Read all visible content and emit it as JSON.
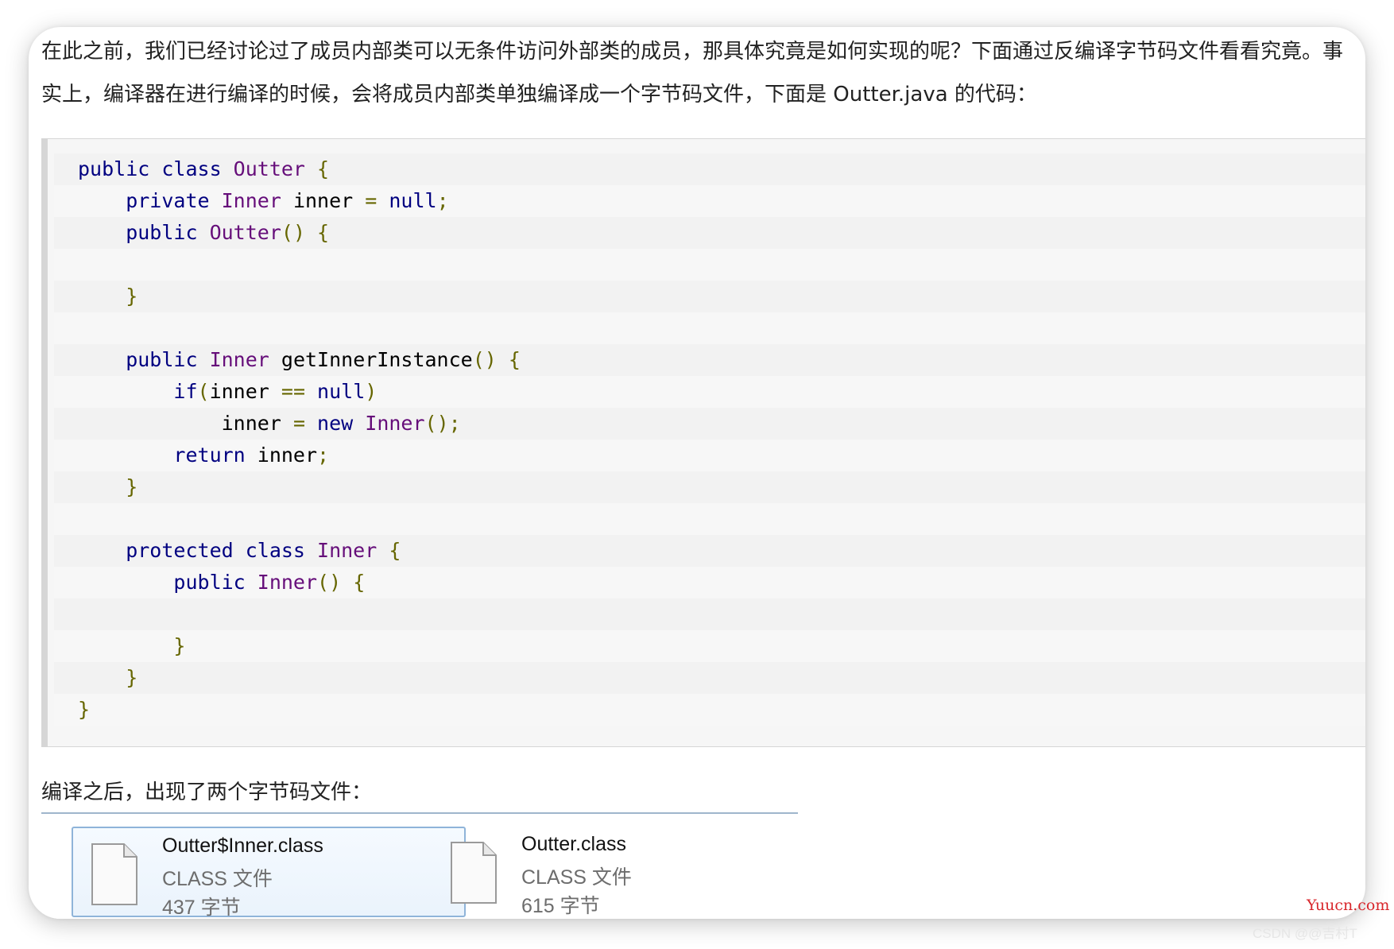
{
  "intro_paragraph": "在此之前，我们已经讨论过了成员内部类可以无条件访问外部类的成员，那具体究竟是如何实现的呢？下面通过反编译字节码文件看看究竟。事实上，编译器在进行编译的时候，会将成员内部类单独编译成一个字节码文件，下面是 Outter.java 的代码：",
  "code_lines": [
    [
      {
        "t": "public class ",
        "c": "kw"
      },
      {
        "t": "Outter",
        "c": "ty"
      },
      {
        "t": " {",
        "c": "pn"
      }
    ],
    [
      {
        "t": "    private ",
        "c": "kw"
      },
      {
        "t": "Inner",
        "c": "ty"
      },
      {
        "t": " inner ",
        "c": "id"
      },
      {
        "t": "=",
        "c": "pn"
      },
      {
        "t": " null",
        "c": "kw"
      },
      {
        "t": ";",
        "c": "pn"
      }
    ],
    [
      {
        "t": "    public ",
        "c": "kw"
      },
      {
        "t": "Outter",
        "c": "ty"
      },
      {
        "t": "() {",
        "c": "pn"
      }
    ],
    [],
    [
      {
        "t": "    }",
        "c": "pn"
      }
    ],
    [],
    [
      {
        "t": "    public ",
        "c": "kw"
      },
      {
        "t": "Inner",
        "c": "ty"
      },
      {
        "t": " getInnerInstance",
        "c": "id"
      },
      {
        "t": "() {",
        "c": "pn"
      }
    ],
    [
      {
        "t": "        if",
        "c": "kw"
      },
      {
        "t": "(",
        "c": "pn"
      },
      {
        "t": "inner ",
        "c": "id"
      },
      {
        "t": "==",
        "c": "pn"
      },
      {
        "t": " null",
        "c": "kw"
      },
      {
        "t": ")",
        "c": "pn"
      }
    ],
    [
      {
        "t": "            inner ",
        "c": "id"
      },
      {
        "t": "=",
        "c": "pn"
      },
      {
        "t": " new ",
        "c": "kw"
      },
      {
        "t": "Inner",
        "c": "ty"
      },
      {
        "t": "();",
        "c": "pn"
      }
    ],
    [
      {
        "t": "        return ",
        "c": "kw"
      },
      {
        "t": "inner",
        "c": "id"
      },
      {
        "t": ";",
        "c": "pn"
      }
    ],
    [
      {
        "t": "    }",
        "c": "pn"
      }
    ],
    [],
    [
      {
        "t": "    protected class ",
        "c": "kw"
      },
      {
        "t": "Inner",
        "c": "ty"
      },
      {
        "t": " {",
        "c": "pn"
      }
    ],
    [
      {
        "t": "        public ",
        "c": "kw"
      },
      {
        "t": "Inner",
        "c": "ty"
      },
      {
        "t": "() {",
        "c": "pn"
      }
    ],
    [],
    [
      {
        "t": "        }",
        "c": "pn"
      }
    ],
    [
      {
        "t": "    }",
        "c": "pn"
      }
    ],
    [
      {
        "t": "}",
        "c": "pn"
      }
    ]
  ],
  "after_compile_text": "编译之后，出现了两个字节码文件：",
  "files": [
    {
      "name": "Outter$Inner.class",
      "type": "CLASS 文件",
      "size": "437 字节",
      "selected": true
    },
    {
      "name": "Outter.class",
      "type": "CLASS 文件",
      "size": "615 字节",
      "selected": false
    }
  ],
  "watermark_site": "Yuucn.com",
  "watermark_csdn": "CSDN @@吉村T"
}
